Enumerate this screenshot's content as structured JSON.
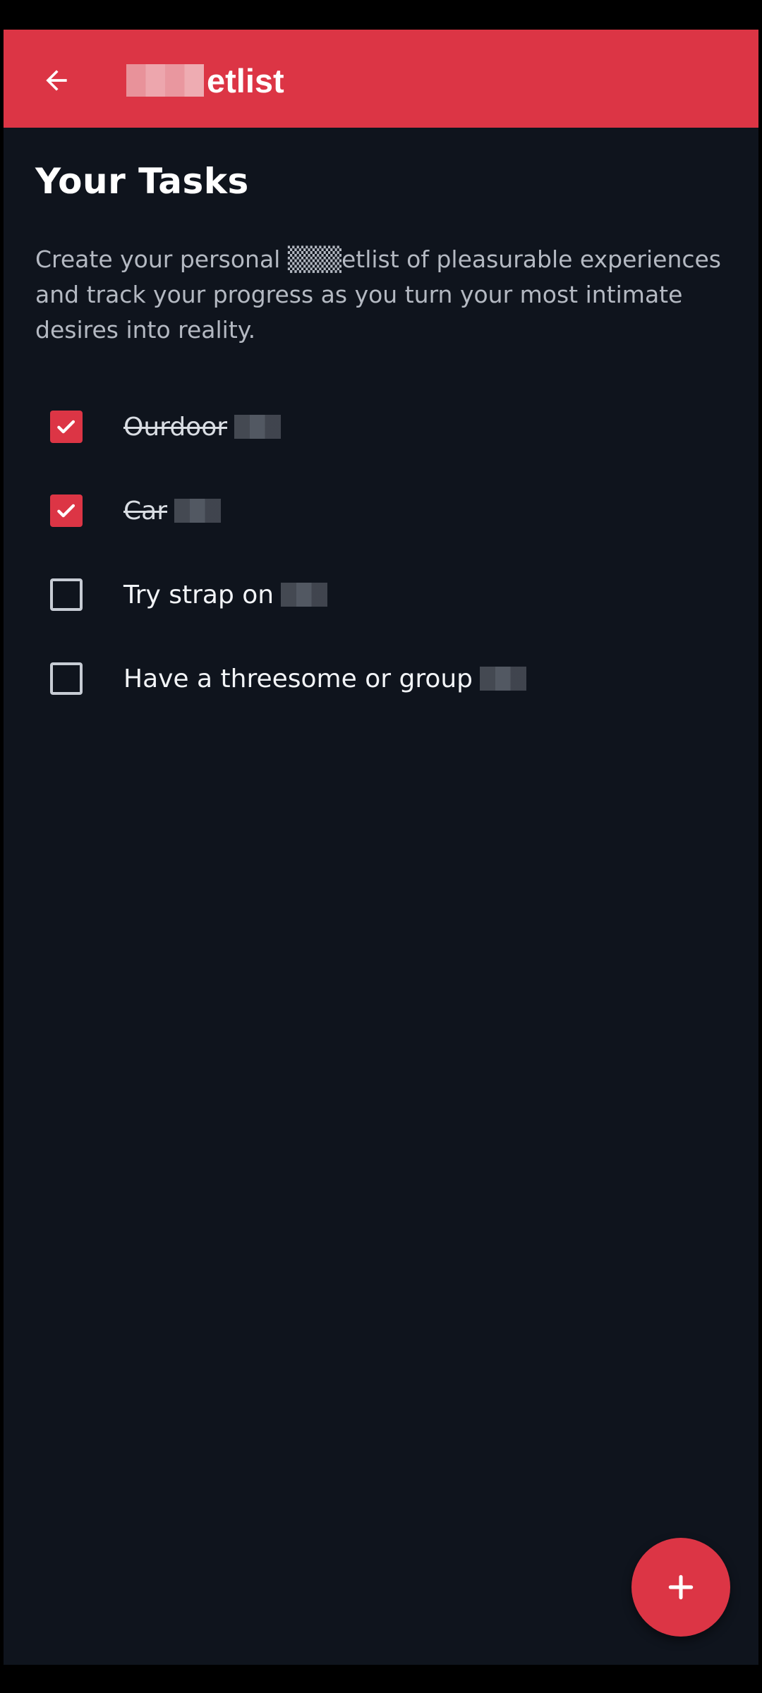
{
  "app_bar": {
    "title_suffix": "etlist",
    "back_icon": "arrow-left-icon",
    "background": "#dc3545"
  },
  "header": {
    "title": "Your Tasks",
    "description": "Create your personal ▒▒▒etlist of pleasurable experiences and track your progress as you turn your most intimate desires into reality."
  },
  "tasks": [
    {
      "label": "Ourdoor",
      "checked": true
    },
    {
      "label": "Car",
      "checked": true
    },
    {
      "label": "Try strap on",
      "checked": false
    },
    {
      "label": "Have a threesome or group",
      "checked": false
    }
  ],
  "fab": {
    "icon": "plus-icon"
  },
  "colors": {
    "accent": "#dc3545",
    "background": "#0f141d",
    "text_primary": "#ffffff",
    "text_secondary": "#b4b9c2"
  }
}
